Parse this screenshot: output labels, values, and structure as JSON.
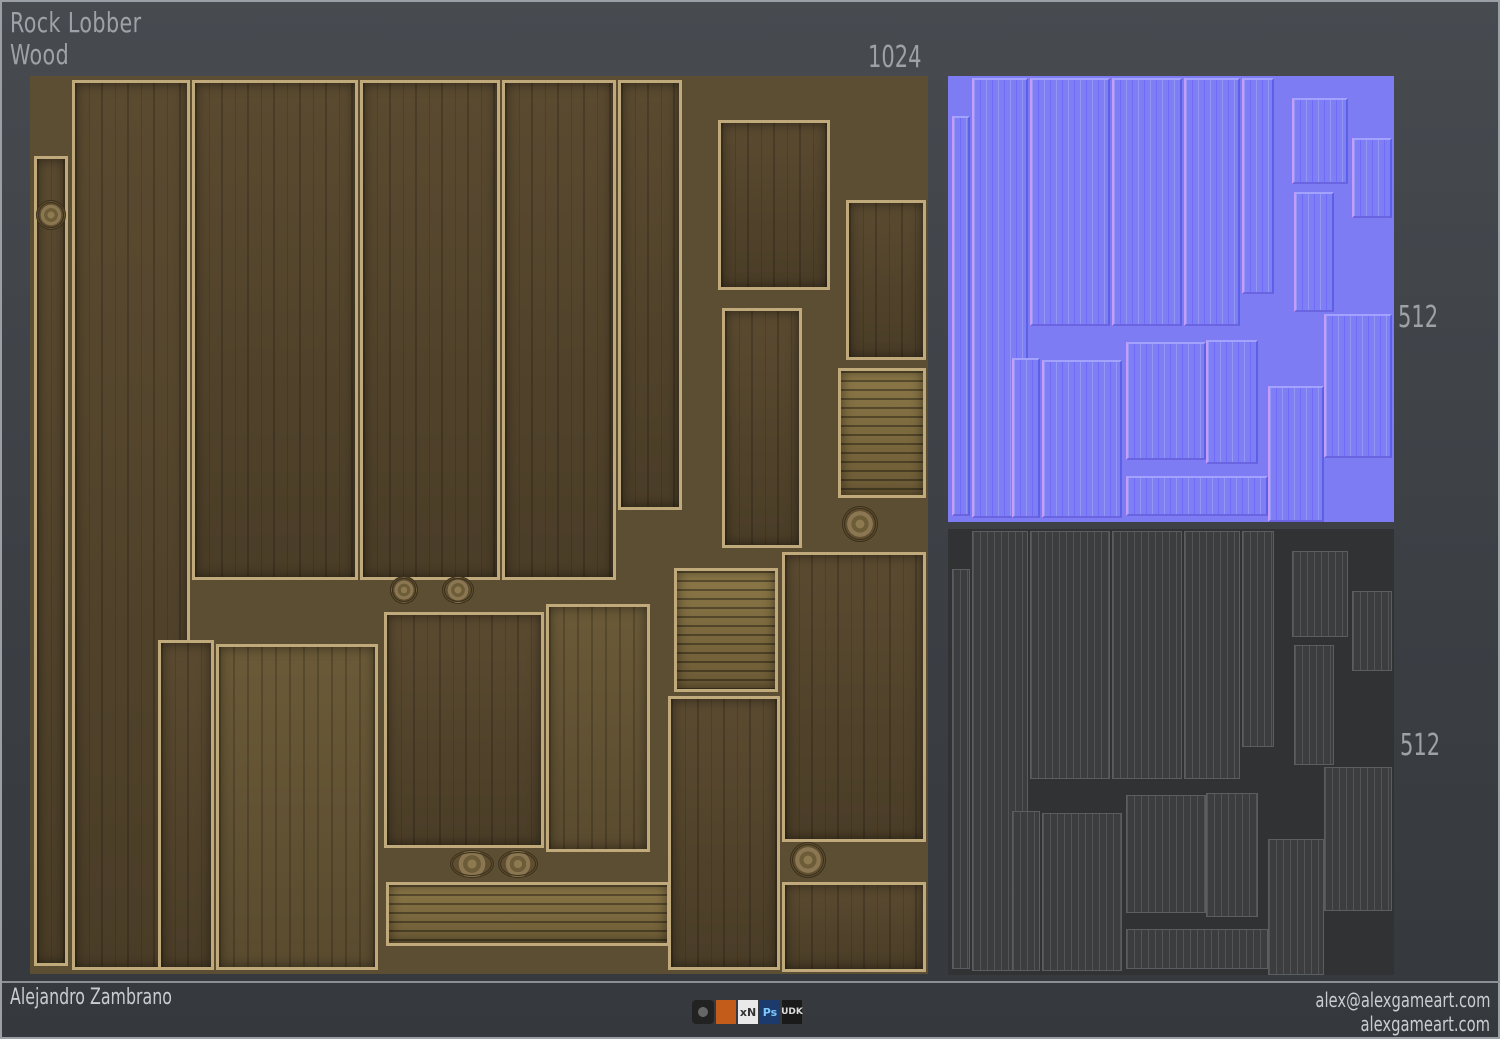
{
  "header": {
    "title_line1": "Rock Lobber",
    "title_line2": "Wood",
    "resolution_main": "1024"
  },
  "maps": {
    "normal_resolution": "512",
    "specular_resolution": "512"
  },
  "footer": {
    "author": "Alejandro Zambrano",
    "email": "alex@alexgameart.com",
    "website": "alexgameart.com",
    "tool_logos": [
      {
        "icon": "zbrush-icon",
        "label": ""
      },
      {
        "icon": "3dsmax-icon",
        "label": ""
      },
      {
        "icon": "xnormal-icon",
        "label": "xN"
      },
      {
        "icon": "photoshop-icon",
        "label": "Ps"
      },
      {
        "icon": "udk-icon",
        "label": "UDK"
      }
    ]
  },
  "colors": {
    "diffuse_base": "#5b4e33",
    "normal_base": "#7d7cf2",
    "specular_base": "#303234",
    "text": "#9ea2a6"
  }
}
